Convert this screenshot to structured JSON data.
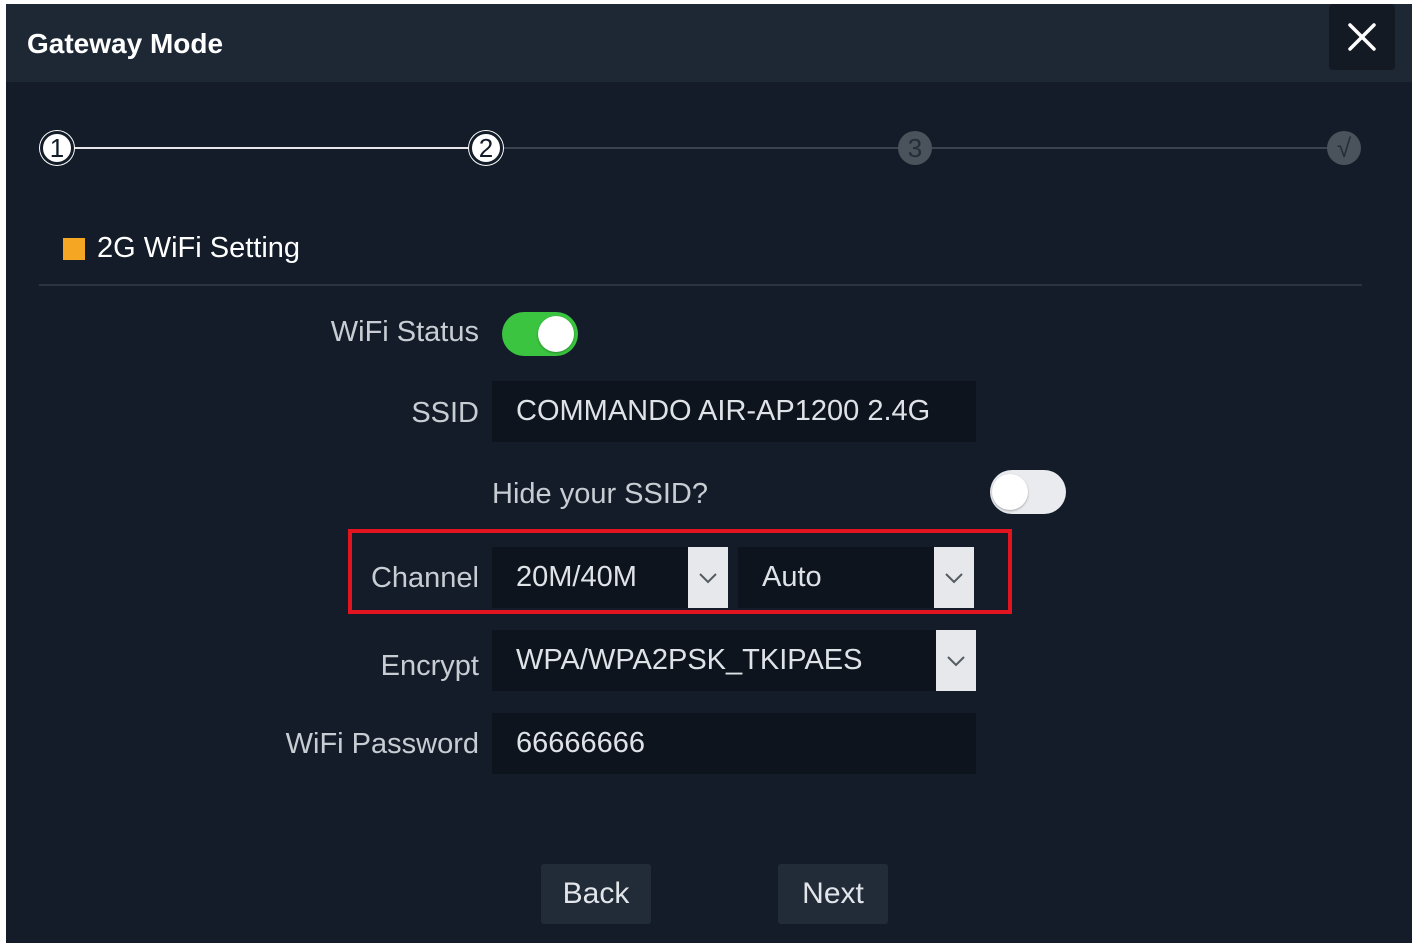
{
  "dialog": {
    "title": "Gateway Mode",
    "close_icon": "close-icon"
  },
  "stepper": {
    "steps": [
      {
        "label": "1",
        "state": "completed"
      },
      {
        "label": "2",
        "state": "current"
      },
      {
        "label": "3",
        "state": "pending"
      },
      {
        "label": "√",
        "state": "pending"
      }
    ]
  },
  "section": {
    "title": "2G WiFi Setting",
    "marker_color": "#f5a623"
  },
  "form": {
    "wifi_status": {
      "label": "WiFi Status",
      "enabled": true
    },
    "ssid": {
      "label": "SSID",
      "value": "COMMANDO AIR-AP1200 2.4G"
    },
    "hide_ssid": {
      "label": "Hide your SSID?",
      "enabled": false
    },
    "channel": {
      "label": "Channel",
      "bandwidth": "20M/40M",
      "channel_value": "Auto"
    },
    "encrypt": {
      "label": "Encrypt",
      "value": "WPA/WPA2PSK_TKIPAES"
    },
    "wifi_password": {
      "label": "WiFi Password",
      "value": "66666666"
    }
  },
  "buttons": {
    "back": "Back",
    "next": "Next"
  },
  "colors": {
    "toggle_on": "#3bc43f",
    "highlight": "#e1141f"
  }
}
